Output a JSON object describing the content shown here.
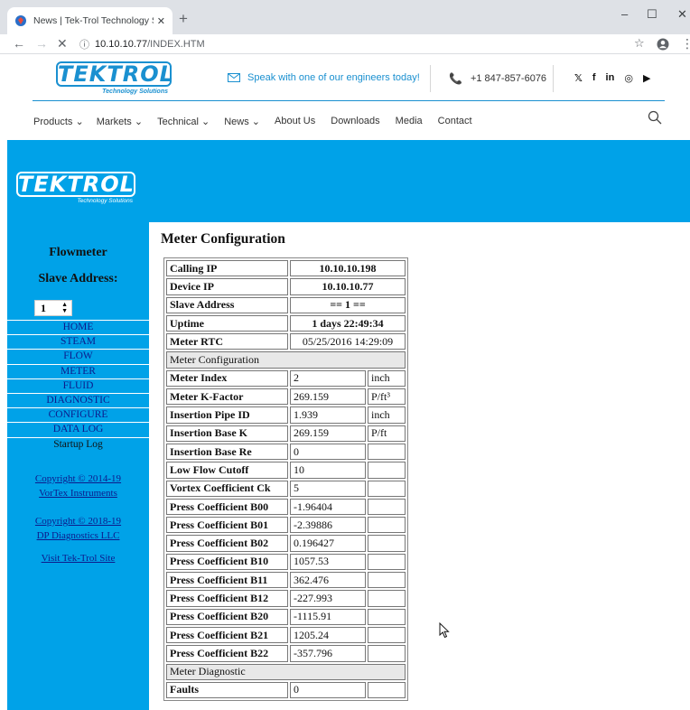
{
  "browser": {
    "tab_title": "News | Tek-Trol Technology Soluti",
    "tab_close": "✕",
    "new_tab": "+",
    "url_host": "10.10.10.77",
    "url_path": "/INDEX.HTM",
    "win_minimize": "–",
    "win_maximize": "☐",
    "win_close": "✕"
  },
  "site": {
    "logo_text": "TEKTROL",
    "logo_sub": "Technology Solutions",
    "cta": "Speak with one of our engineers today!",
    "phone": "+1 847-857-6076",
    "social": [
      "𝕏",
      "f",
      "in",
      "◎",
      "▶"
    ],
    "nav": [
      "Products ⌄",
      "Markets ⌄",
      "Technical ⌄",
      "News ⌄",
      "About Us",
      "Downloads",
      "Media",
      "Contact"
    ],
    "accent": "#00a2e8"
  },
  "sidebar": {
    "title1": "Flowmeter",
    "title2": "Slave Address:",
    "slave_value": "1",
    "menu": [
      "HOME",
      "STEAM",
      "FLOW",
      "METER",
      "FLUID",
      "DIAGNOSTIC",
      "CONFIGURE",
      "DATA LOG",
      "Startup Log"
    ],
    "copy1_a": "Copyright © 2014-19",
    "copy1_b": "VorTex Instruments",
    "copy2_a": "Copyright © 2018-19",
    "copy2_b": "DP Diagnostics LLC",
    "visit": "Visit Tek-Trol Site"
  },
  "main": {
    "heading": "Meter Configuration",
    "info_rows": [
      {
        "label": "Calling IP",
        "value": "10.10.10.198"
      },
      {
        "label": "Device IP",
        "value": "10.10.10.77"
      },
      {
        "label": "Slave Address",
        "value": "== 1 =="
      },
      {
        "label": "Uptime",
        "value": "1 days 22:49:34"
      },
      {
        "label": "Meter RTC",
        "value": "05/25/2016   14:29:09"
      }
    ],
    "section1": "Meter Configuration",
    "config_rows": [
      {
        "label": "Meter Index",
        "value": "2",
        "unit": "inch"
      },
      {
        "label": "Meter K-Factor",
        "value": "269.159",
        "unit": "P/ft³"
      },
      {
        "label": "Insertion Pipe ID",
        "value": "1.939",
        "unit": "inch"
      },
      {
        "label": "Insertion Base K",
        "value": "269.159",
        "unit": "P/ft"
      },
      {
        "label": "Insertion Base Re",
        "value": "0",
        "unit": ""
      },
      {
        "label": "Low Flow Cutoff",
        "value": "10",
        "unit": ""
      },
      {
        "label": "Vortex Coefficient Ck",
        "value": "5",
        "unit": ""
      },
      {
        "label": "Press Coefficient B00",
        "value": "-1.96404",
        "unit": ""
      },
      {
        "label": "Press Coefficient B01",
        "value": "-2.39886",
        "unit": ""
      },
      {
        "label": "Press Coefficient B02",
        "value": "0.196427",
        "unit": ""
      },
      {
        "label": "Press Coefficient B10",
        "value": "1057.53",
        "unit": ""
      },
      {
        "label": "Press Coefficient B11",
        "value": "362.476",
        "unit": ""
      },
      {
        "label": "Press Coefficient B12",
        "value": "-227.993",
        "unit": ""
      },
      {
        "label": "Press Coefficient B20",
        "value": "-1115.91",
        "unit": ""
      },
      {
        "label": "Press Coefficient B21",
        "value": "1205.24",
        "unit": ""
      },
      {
        "label": "Press Coefficient B22",
        "value": "-357.796",
        "unit": ""
      }
    ],
    "section2": "Meter Diagnostic",
    "diag_rows": [
      {
        "label": "Faults",
        "value": "0",
        "unit": ""
      }
    ]
  }
}
